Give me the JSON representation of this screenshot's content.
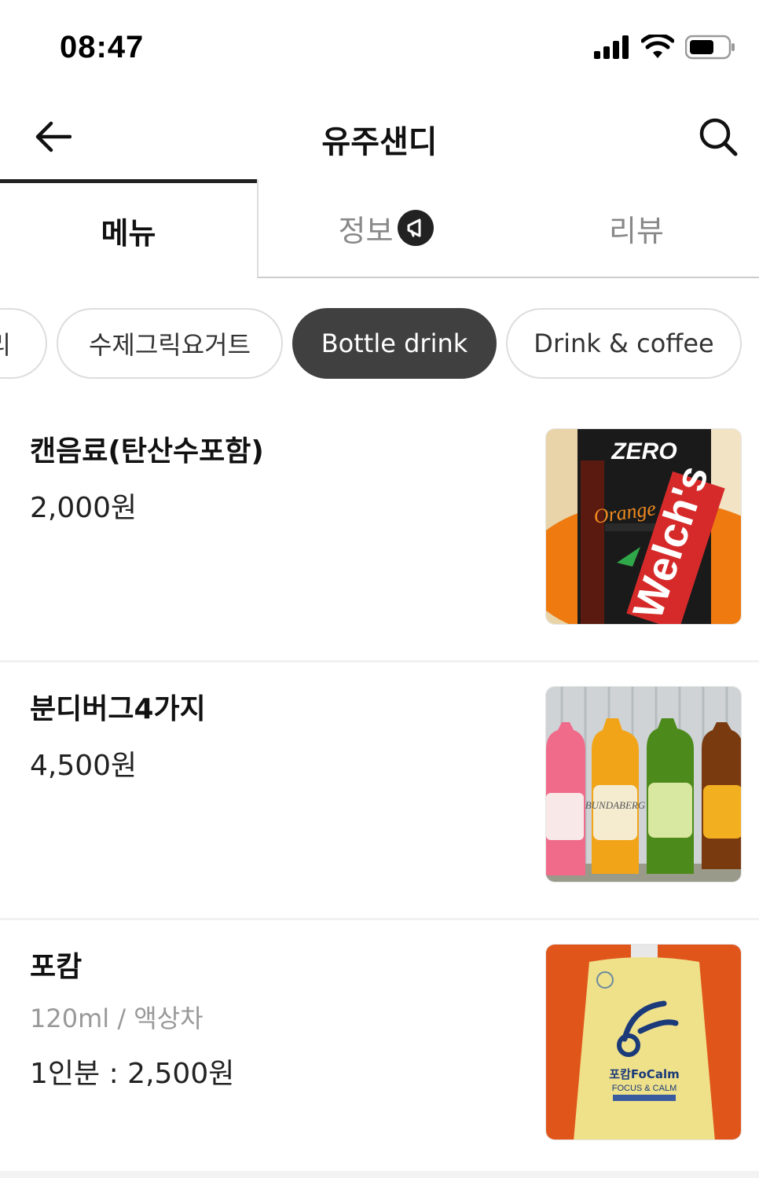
{
  "status": {
    "time": "08:47"
  },
  "header": {
    "title": "유주샌디"
  },
  "tabs": {
    "menu": "메뉴",
    "info": "정보",
    "review": "리뷰"
  },
  "chips": {
    "partial": "리",
    "yogurt": "수제그릭요거트",
    "bottle": "Bottle drink",
    "drink": "Drink & coffee"
  },
  "items": [
    {
      "name": "캔음료(탄산수포함)",
      "price": "2,000원",
      "image_text_top": "ZERO",
      "image_text_brand": "Welch's",
      "image_text_flavor": "Orange"
    },
    {
      "name": "분디버그4가지",
      "price": "4,500원",
      "image_text_brand": "BUNDABERG"
    },
    {
      "name": "포캄",
      "desc": "120ml / 액상차",
      "price": "1인분 : 2,500원",
      "image_text_brand": "포캄FoCalm",
      "image_text_sub": "FOCUS & CALM"
    }
  ],
  "colors": {
    "accent": "#404040",
    "tab_active": "#222222",
    "muted": "#888888"
  }
}
